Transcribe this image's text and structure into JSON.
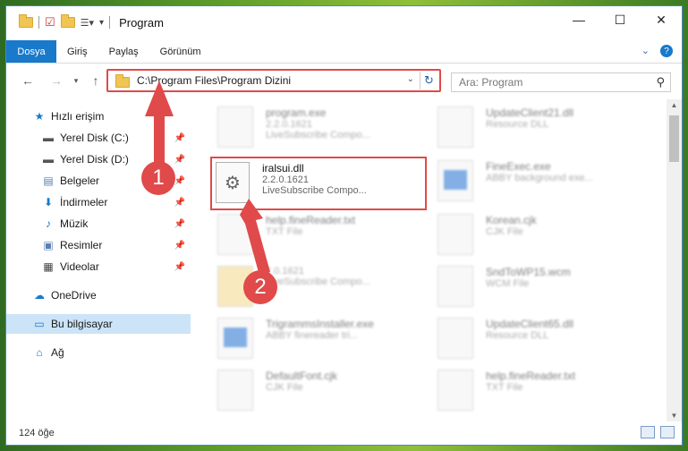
{
  "window": {
    "title": "Program",
    "controls": {
      "minimize": "—",
      "maximize": "☐",
      "close": "✕"
    }
  },
  "ribbon": {
    "tabs": [
      "Dosya",
      "Giriş",
      "Paylaş",
      "Görünüm"
    ]
  },
  "address": {
    "path": "C:\\Program Files\\Program Dizini",
    "search_placeholder": "Ara: Program"
  },
  "nav": {
    "quick_access": "Hızlı erişim",
    "items": [
      {
        "label": "Yerel Disk (C:)",
        "icon": "drive-icon"
      },
      {
        "label": "Yerel Disk (D:)",
        "icon": "drive-icon"
      },
      {
        "label": "Belgeler",
        "icon": "documents-icon"
      },
      {
        "label": "İndirmeler",
        "icon": "downloads-icon"
      },
      {
        "label": "Müzik",
        "icon": "music-icon"
      },
      {
        "label": "Resimler",
        "icon": "pictures-icon"
      },
      {
        "label": "Videolar",
        "icon": "videos-icon"
      }
    ],
    "onedrive": "OneDrive",
    "this_pc": "Bu bilgisayar",
    "network": "Ağ"
  },
  "files": {
    "left": [
      {
        "name": "program.exe",
        "line2": "2.2.0.1621",
        "line3": "LiveSubscribe Compo..."
      },
      {
        "name": "iralsui.dll",
        "line2": "2.2.0.1621",
        "line3": "LiveSubscribe Compo..."
      },
      {
        "name": "help.fineReader.txt",
        "line2": "TXT File",
        "line3": ""
      },
      {
        "name": "",
        "line2": "2.0.1621",
        "line3": "LiveSubscribe Compo..."
      },
      {
        "name": "TrigrammsInstaller.exe",
        "line2": "ABBY finereader tri...",
        "line3": ""
      },
      {
        "name": "DefaultFont.cjk",
        "line2": "CJK File",
        "line3": ""
      }
    ],
    "right": [
      {
        "name": "UpdateClient21.dll",
        "line2": "Resource DLL",
        "line3": ""
      },
      {
        "name": "FineExec.exe",
        "line2": "ABBY background exe...",
        "line3": ""
      },
      {
        "name": "Korean.cjk",
        "line2": "CJK File",
        "line3": ""
      },
      {
        "name": "SndToWP15.wcm",
        "line2": "WCM File",
        "line3": ""
      },
      {
        "name": "UpdateClient65.dll",
        "line2": "Resource DLL",
        "line3": ""
      },
      {
        "name": "help.fineReader.txt",
        "line2": "TXT File",
        "line3": ""
      }
    ]
  },
  "status": {
    "count": "124 öğe"
  },
  "annotations": {
    "step1": "1",
    "step2": "2"
  },
  "colors": {
    "accent": "#1979ca",
    "highlight": "#e04a4a",
    "selected": "#cce4f7"
  }
}
